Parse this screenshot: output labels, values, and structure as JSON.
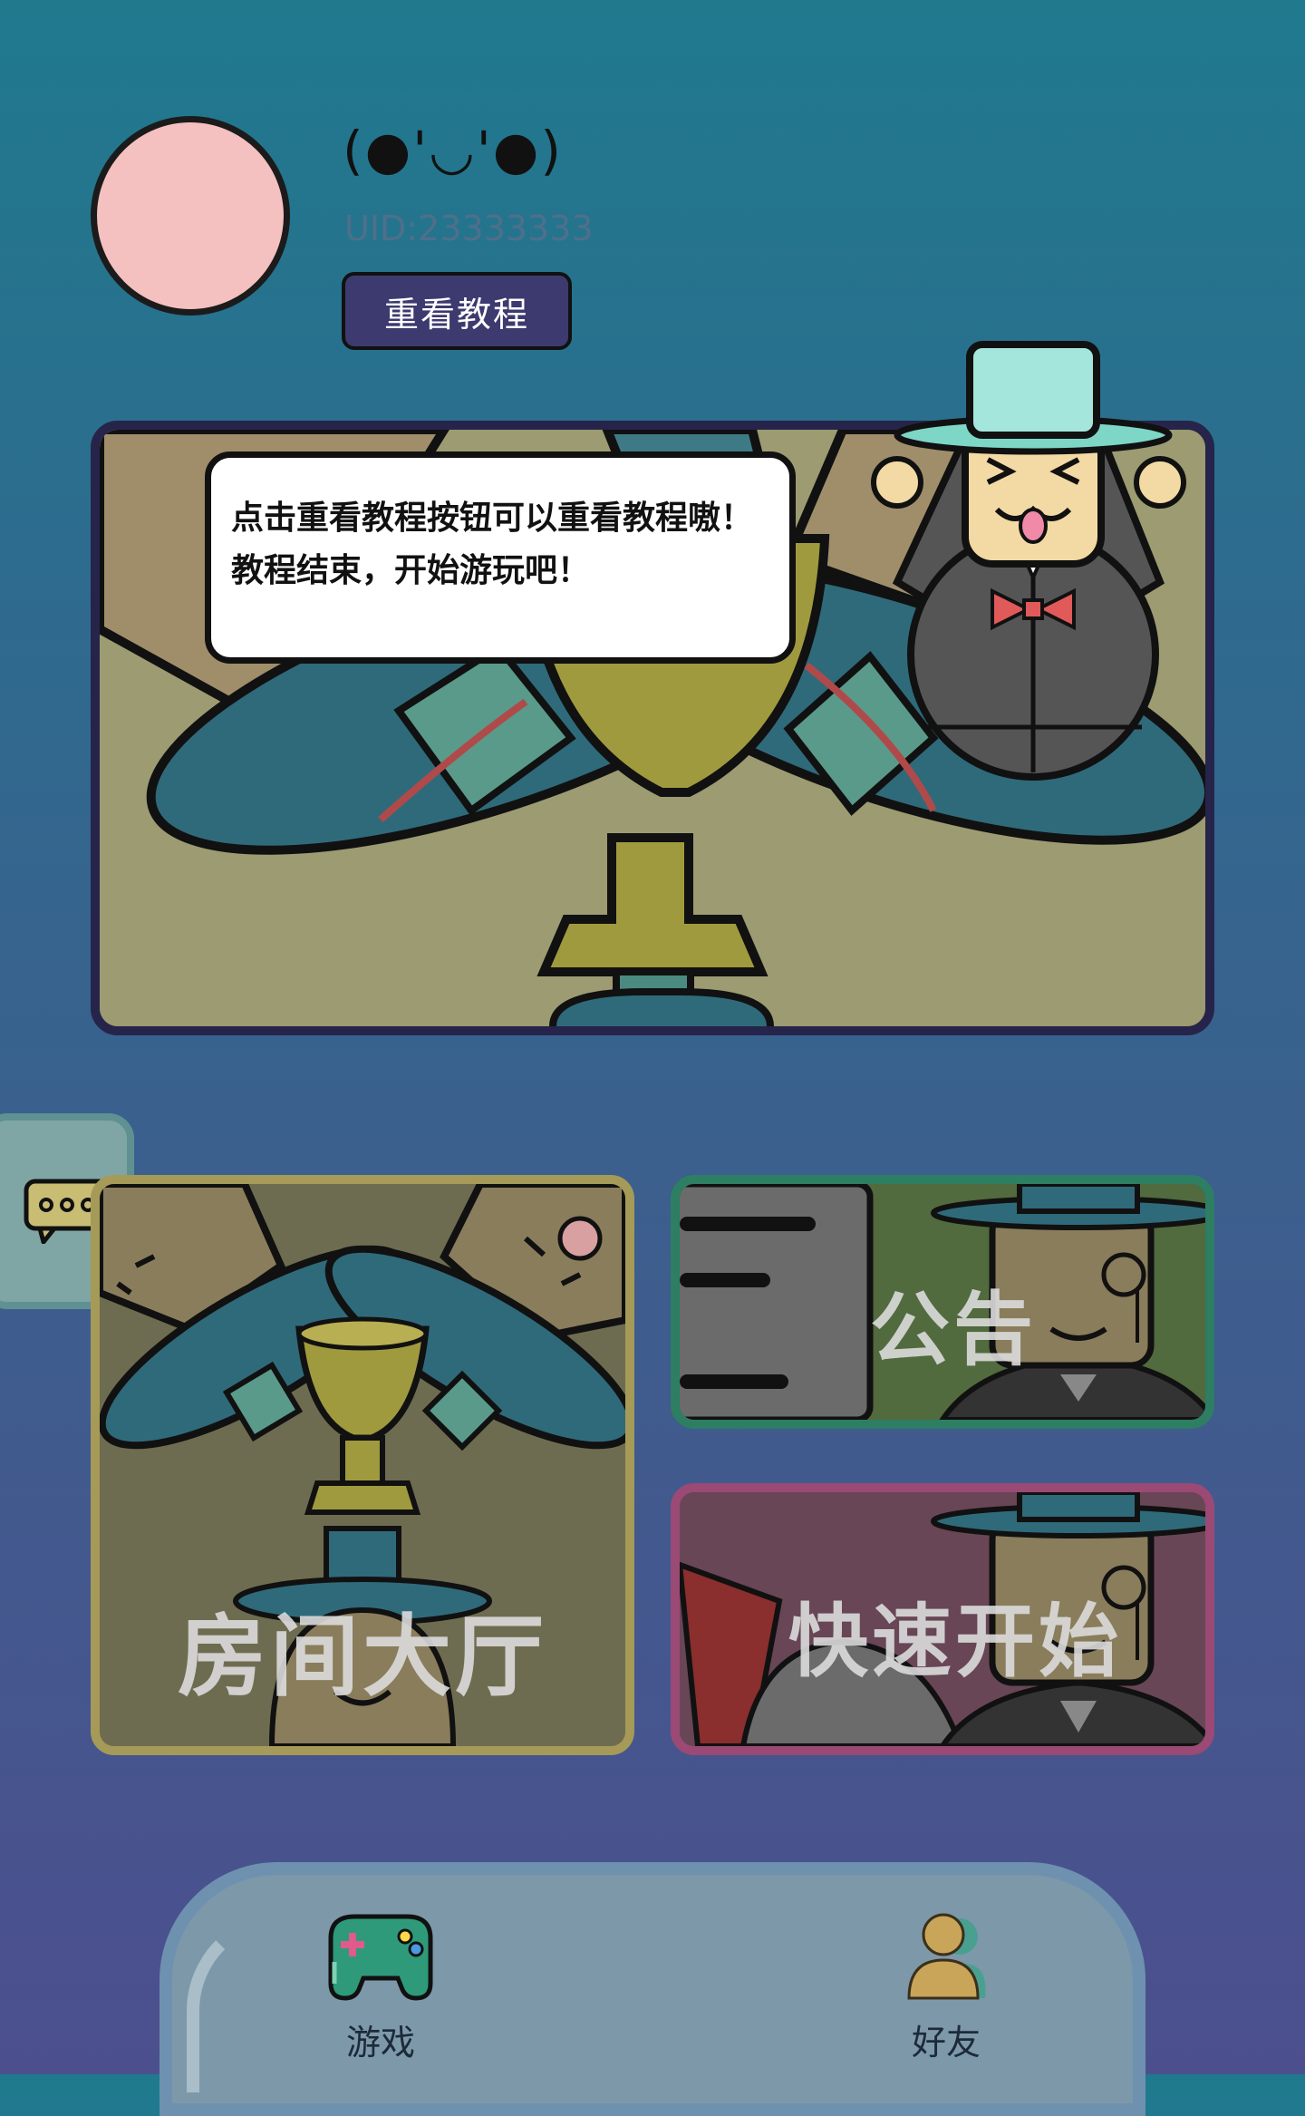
{
  "profile": {
    "nickname": "(●'◡'●)",
    "uid": "UID:23333333",
    "retutorial_label": "重看教程"
  },
  "banner": {
    "tip_text": "点击重看教程按钮可以重看教程嗷！教程结束，开始游玩吧！"
  },
  "cards": {
    "room_hall": "房间大厅",
    "notice": "公告",
    "quick_start": "快速开始"
  },
  "bottom_nav": {
    "items": [
      {
        "label": "游戏",
        "icon": "gamepad-icon"
      },
      {
        "label": "好友",
        "icon": "friends-icon"
      }
    ]
  },
  "colors": {
    "avatar": "#f4c0c0",
    "button": "#3c3a6e",
    "room_border": "#a59a57",
    "notice_border": "#2d7e62",
    "quick_border": "#9a4a74"
  }
}
